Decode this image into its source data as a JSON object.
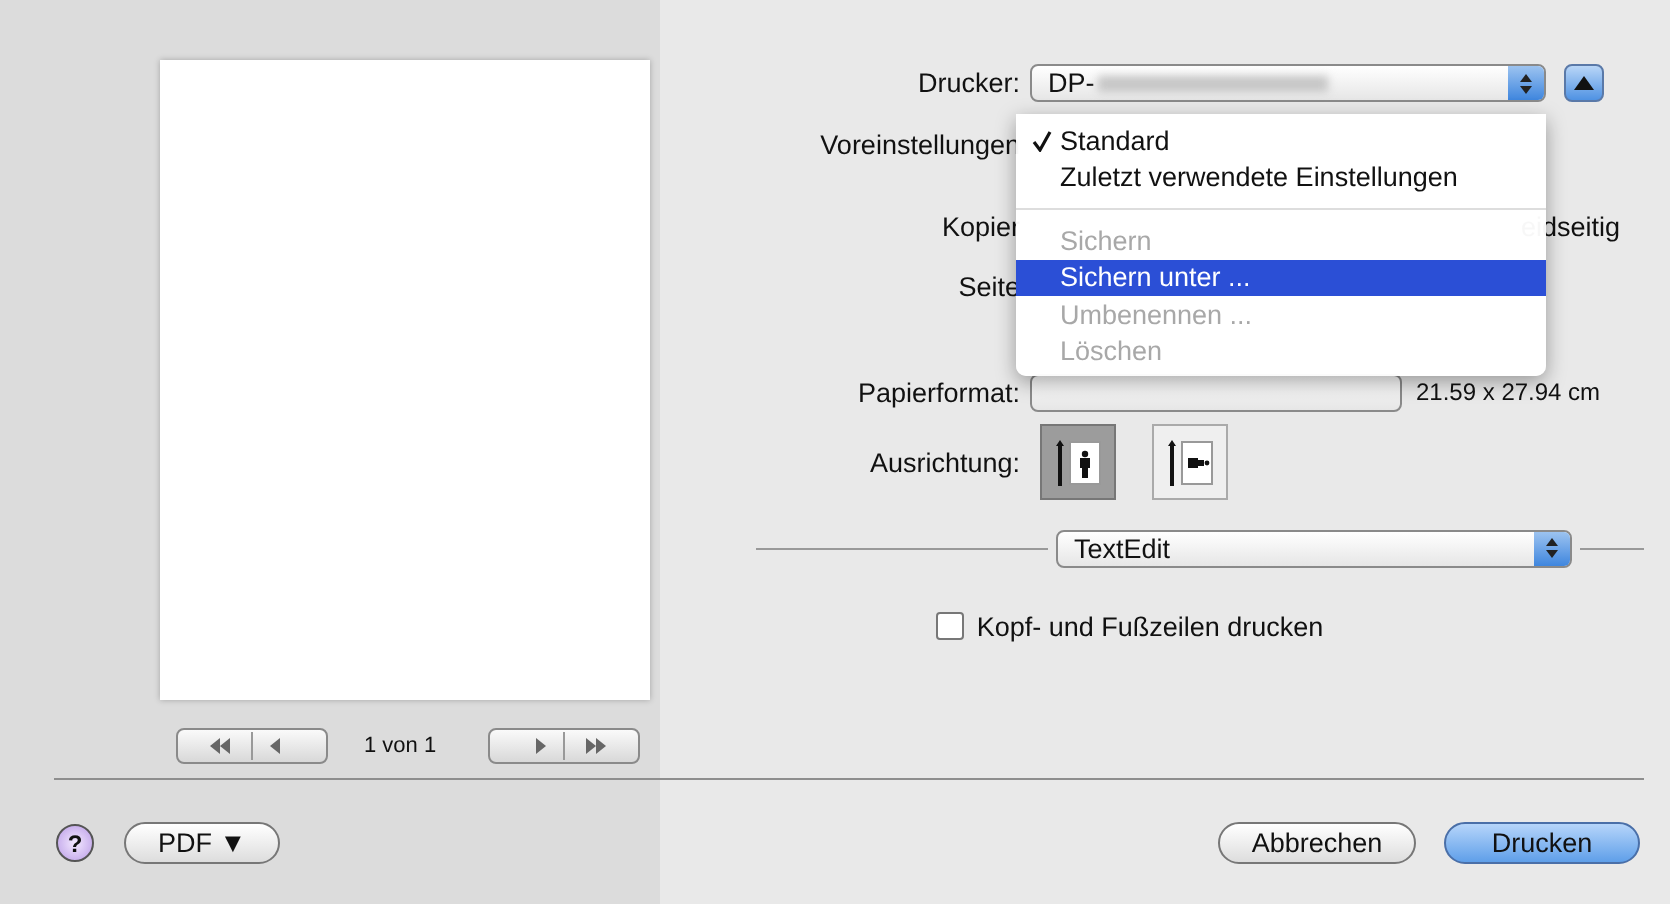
{
  "preview": {
    "page_label": "1 von 1"
  },
  "printer": {
    "label": "Drucker:",
    "value": "DP-"
  },
  "presets": {
    "label": "Voreinstellungen"
  },
  "copies": {
    "label": "Kopier",
    "duplex_label": "eidseitig"
  },
  "pages": {
    "label": "Seite"
  },
  "paper": {
    "label": "Papierformat:",
    "size": "21.59 x 27.94 cm"
  },
  "orientation": {
    "label": "Ausrichtung:",
    "options": [
      {
        "kind": "portrait",
        "selected": true
      },
      {
        "kind": "landscape",
        "selected": false
      }
    ]
  },
  "section_popup": {
    "value": "TextEdit"
  },
  "header_footer": {
    "label": "Kopf- und Fußzeilen drucken",
    "checked": false
  },
  "menu": {
    "items": [
      {
        "kind": "item",
        "label": "Standard",
        "checked": true,
        "disabled": false,
        "selected": false
      },
      {
        "kind": "item",
        "label": "Zuletzt verwendete Einstellungen",
        "checked": false,
        "disabled": false,
        "selected": false
      },
      {
        "kind": "separator"
      },
      {
        "kind": "item",
        "label": "Sichern",
        "checked": false,
        "disabled": true,
        "selected": false
      },
      {
        "kind": "item",
        "label": "Sichern unter ...",
        "checked": false,
        "disabled": false,
        "selected": true
      },
      {
        "kind": "item",
        "label": "Umbenennen ...",
        "checked": false,
        "disabled": true,
        "selected": false
      },
      {
        "kind": "item",
        "label": "Löschen",
        "checked": false,
        "disabled": true,
        "selected": false
      }
    ]
  },
  "buttons": {
    "help": "?",
    "pdf": "PDF",
    "pdf_arrow": "▼",
    "cancel": "Abbrechen",
    "print": "Drucken"
  }
}
